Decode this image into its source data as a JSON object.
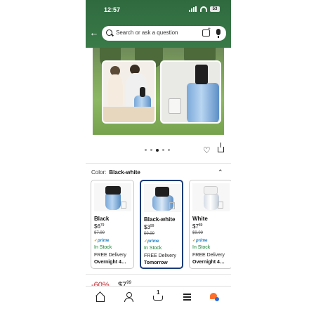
{
  "status_bar": {
    "time": "12:57",
    "battery": "53"
  },
  "search": {
    "placeholder": "Search or ask a question"
  },
  "carousel": {
    "total_dots": 5,
    "active_index": 2
  },
  "color_selector": {
    "label": "Color:",
    "value": "Black-white"
  },
  "variants": [
    {
      "name": "Black",
      "price_whole": "$6",
      "price_fraction": "79",
      "was_price": "$7.99",
      "prime_label": "prime",
      "stock": "In Stock",
      "delivery": "FREE Delivery",
      "eta": "Overnight 4…",
      "selected": false
    },
    {
      "name": "Black-white",
      "price_whole": "$3",
      "price_fraction": "99",
      "was_price": "$9.99",
      "prime_label": "prime",
      "stock": "In Stock",
      "delivery": "FREE Delivery",
      "eta": "Tomorrow",
      "selected": true
    },
    {
      "name": "White",
      "price_whole": "$7",
      "price_fraction": "89",
      "was_price": "$9.99",
      "prime_label": "prime",
      "stock": "In Stock",
      "delivery": "FREE Delivery",
      "eta": "Overnight 4…",
      "selected": false
    }
  ],
  "price_peek": {
    "discount": "-60%",
    "price_whole": "$7",
    "price_fraction": "99"
  },
  "bottom_nav": {
    "cart_count": "1"
  },
  "colors": {
    "header": "#2f6a3f",
    "selected_border": "#1a3b78",
    "in_stock": "#0f7d2e",
    "discount": "#c0262d",
    "prime": "#1a7fc1"
  },
  "icons": [
    "back-arrow-icon",
    "search-icon",
    "camera-search-icon",
    "microphone-icon",
    "heart-icon",
    "share-icon",
    "chevron-up-icon",
    "home-icon",
    "account-icon",
    "cart-icon",
    "menu-icon",
    "assistant-icon"
  ]
}
